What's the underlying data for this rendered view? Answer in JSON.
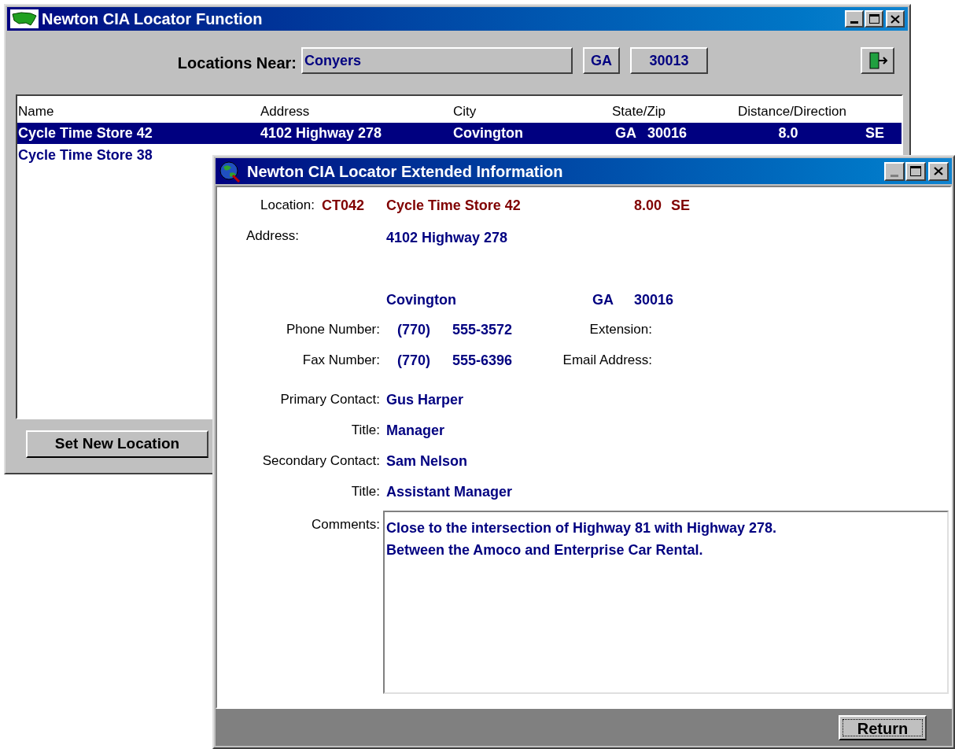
{
  "main_window": {
    "title": "Newton CIA Locator Function",
    "locations_near": {
      "label": "Locations Near:",
      "city": "Conyers",
      "state": "GA",
      "zip": "30013"
    },
    "table": {
      "columns": [
        "Name",
        "Address",
        "City",
        "State/Zip",
        "Distance/Direction"
      ],
      "rows": [
        {
          "selected": true,
          "name": "Cycle Time Store 42",
          "address": "4102 Highway 278",
          "city": "Covington",
          "state": "GA",
          "zip": "30016",
          "distance": "8.0",
          "direction": "SE"
        },
        {
          "selected": false,
          "name": "Cycle Time Store 38"
        }
      ]
    },
    "button": "Set New Location"
  },
  "detail_window": {
    "title": "Newton CIA Locator Extended Information",
    "location": {
      "label": "Location:",
      "code": "CT042",
      "name": "Cycle Time Store 42",
      "distance": "8.00",
      "direction": "SE"
    },
    "address": {
      "label": "Address:",
      "line_1": "4102 Highway 278"
    },
    "city_line": {
      "city": "Covington",
      "state": "GA",
      "zip": "30016"
    },
    "phone": {
      "label": "Phone Number:",
      "area_code": "(770)",
      "number": "555-3572",
      "side_label": "Extension:"
    },
    "fax": {
      "label": "Fax Number:",
      "area_code": "(770)",
      "number": "555-6396",
      "side_label": "Email Address:"
    },
    "contacts": [
      {
        "label": "Primary Contact:",
        "value": "Gus Harper"
      },
      {
        "label": "Title:",
        "value": "Manager"
      },
      {
        "label": "Secondary Contact:",
        "value": "Sam Nelson"
      },
      {
        "label": "Title:",
        "value": "Assistant Manager"
      }
    ],
    "comments": {
      "label": "Comments:",
      "lines": [
        "Close to the intersection of Highway 81 with Highway 278.",
        "Between the Amoco and Enterprise Car Rental."
      ]
    },
    "button": "Return"
  }
}
